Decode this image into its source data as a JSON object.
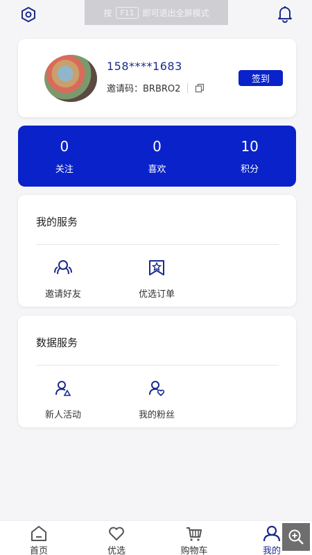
{
  "topbar": {
    "fullscreen_hint_prefix": "按",
    "fullscreen_hint_key": "F11",
    "fullscreen_hint_suffix": "即可退出全屏模式"
  },
  "profile": {
    "phone": "158****1683",
    "invite_label": "邀请码：BRBRO2",
    "signin_label": "签到"
  },
  "stats": [
    {
      "value": "0",
      "label": "关注"
    },
    {
      "value": "0",
      "label": "喜欢"
    },
    {
      "value": "10",
      "label": "积分"
    }
  ],
  "services": [
    {
      "title": "我的服务",
      "items": [
        {
          "label": "邀请好友",
          "icon": "invite-friends-icon"
        },
        {
          "label": "优选订单",
          "icon": "order-icon"
        }
      ]
    },
    {
      "title": "数据服务",
      "items": [
        {
          "label": "新人活动",
          "icon": "new-user-icon"
        },
        {
          "label": "我的粉丝",
          "icon": "fans-icon"
        }
      ]
    }
  ],
  "nav": [
    {
      "label": "首页",
      "icon": "home-icon"
    },
    {
      "label": "优选",
      "icon": "heart-icon"
    },
    {
      "label": "购物车",
      "icon": "cart-icon"
    },
    {
      "label": "我的",
      "icon": "profile-icon"
    }
  ],
  "colors": {
    "accent": "#0a22c9",
    "accent_text": "#1a2a8c",
    "background": "#f5f5f7"
  }
}
